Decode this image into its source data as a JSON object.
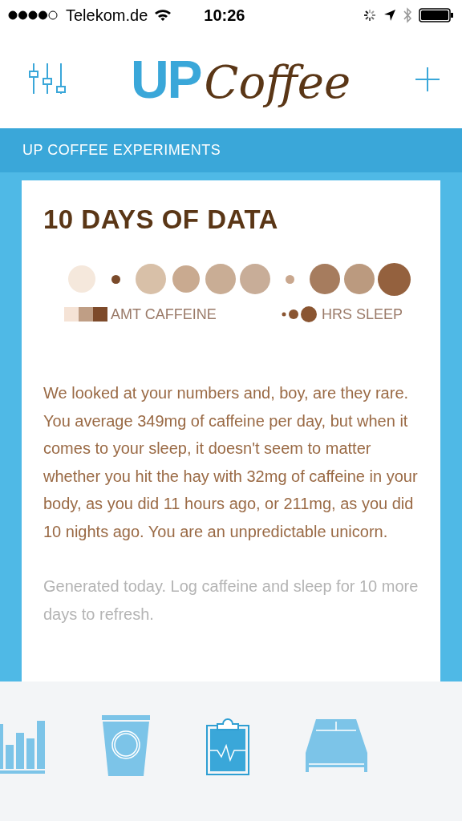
{
  "status_bar": {
    "carrier": "Telekom.de",
    "time": "10:26"
  },
  "header": {
    "logo_up": "UP",
    "logo_coffee": "Coffee"
  },
  "section_title": "UP COFFEE EXPERIMENTS",
  "card": {
    "title": "10 DAYS OF DATA",
    "dots": [
      {
        "color": "#f5e8dc",
        "kind": "medium"
      },
      {
        "color": "#7a4a2a",
        "kind": "small"
      },
      {
        "color": "#d8c0a8",
        "kind": "large"
      },
      {
        "color": "#c9aa90",
        "kind": "medium"
      },
      {
        "color": "#c9ad95",
        "kind": "large"
      },
      {
        "color": "#c8ad98",
        "kind": "large"
      },
      {
        "color": "#c9a78e",
        "kind": "small"
      },
      {
        "color": "#a67c5e",
        "kind": "large"
      },
      {
        "color": "#bb9a7f",
        "kind": "large"
      },
      {
        "color": "#94613e",
        "kind": "xlarge"
      }
    ],
    "legend_caffeine": "AMT CAFFEINE",
    "legend_sleep": "HRS SLEEP",
    "summary": "We looked at your numbers and, boy, are they rare. You average 349mg of caffeine per day, but when it comes to your sleep, it doesn't seem to matter whether you hit the hay with 32mg of caffeine in your body, as you did 11 hours ago, or 211mg, as you did 10 nights ago. You are an unpredictable unicorn.",
    "footnote": "Generated today. Log caffeine and sleep for 10 more days to refresh."
  },
  "tabs": [
    {
      "kind": "chart",
      "selected": false
    },
    {
      "kind": "cup",
      "selected": false
    },
    {
      "kind": "clipboard",
      "selected": true
    },
    {
      "kind": "bed",
      "selected": false
    }
  ]
}
